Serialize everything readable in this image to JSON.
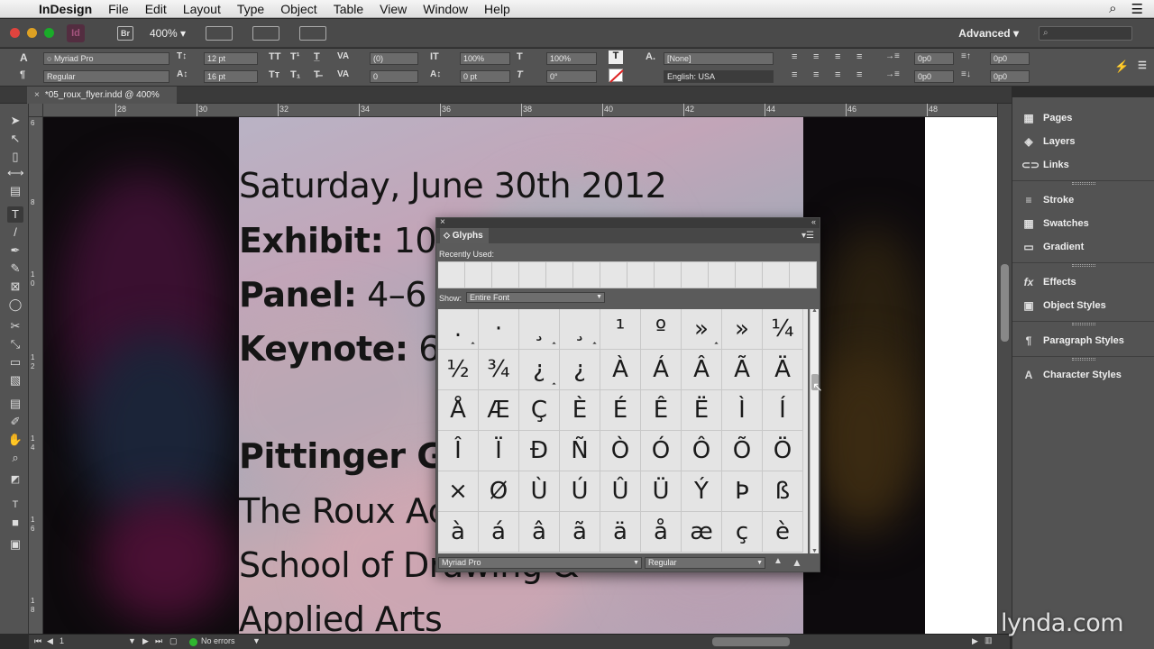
{
  "menubar": {
    "app": "InDesign",
    "items": [
      "File",
      "Edit",
      "Layout",
      "Type",
      "Object",
      "Table",
      "View",
      "Window",
      "Help"
    ]
  },
  "appbar": {
    "bridge": "Br",
    "zoom": "400%",
    "workspace": "Advanced"
  },
  "control": {
    "font_family": "Myriad Pro",
    "font_style": "Regular",
    "font_size": "12 pt",
    "leading": "16 pt",
    "kerning": "(0)",
    "tracking": "0",
    "vscale": "100%",
    "hscale": "100%",
    "baseline": "0 pt",
    "skew": "0°",
    "char_style": "[None]",
    "language": "English: USA",
    "indent_left": "0p0",
    "indent_right": "0p0",
    "indent_first": "0p0",
    "indent_last": "0p0",
    "space_before": "0p0",
    "space_after": "0p0"
  },
  "tab": {
    "title": "*05_roux_flyer.indd @ 400%"
  },
  "ruler": {
    "labels": [
      "28",
      "30",
      "32",
      "34",
      "36",
      "38",
      "40",
      "42",
      "44",
      "46",
      "48"
    ],
    "v_labels": [
      "6",
      "8",
      "1",
      "0",
      "1",
      "2",
      "1",
      "4",
      "1",
      "6",
      "1",
      "8"
    ]
  },
  "flyer": {
    "line1": "Saturday, June 30th 2012",
    "line2_bold": "Exhibit:",
    "line2_rest": " 10",
    "line3_bold": "Panel:",
    "line3_rest": " 4–6",
    "line4_bold": "Keynote:",
    "line4_rest": " 6",
    "line5": "Pittinger G",
    "line6": "The Roux Ac",
    "line7": "School of Drawing &",
    "line8": "Applied Arts"
  },
  "glyphs_panel": {
    "title": "Glyphs",
    "recently_used_label": "Recently Used:",
    "show_label": "Show:",
    "show_value": "Entire Font",
    "font": "Myriad Pro",
    "style": "Regular",
    "grid": [
      ".",
      "·",
      "¸",
      "¸",
      "¹",
      "º",
      "»",
      "»",
      "¼",
      "½",
      "¾",
      "¿",
      "¿",
      "À",
      "Á",
      "Â",
      "Ã",
      "Ä",
      "Å",
      "Æ",
      "Ç",
      "È",
      "É",
      "Ê",
      "Ë",
      "Ì",
      "Í",
      "Î",
      "Ï",
      "Ð",
      "Ñ",
      "Ò",
      "Ó",
      "Ô",
      "Õ",
      "Ö",
      "×",
      "Ø",
      "Ù",
      "Ú",
      "Û",
      "Ü",
      "Ý",
      "Þ",
      "ß",
      "à",
      "á",
      "â",
      "ã",
      "ä",
      "å",
      "æ",
      "ç",
      "è"
    ]
  },
  "panels": {
    "items": [
      "Pages",
      "Layers",
      "Links",
      "Stroke",
      "Swatches",
      "Gradient",
      "Effects",
      "Object Styles",
      "Paragraph Styles",
      "Character Styles"
    ]
  },
  "status": {
    "page": "1",
    "errors": "No errors"
  },
  "watermark": "lynda.com"
}
